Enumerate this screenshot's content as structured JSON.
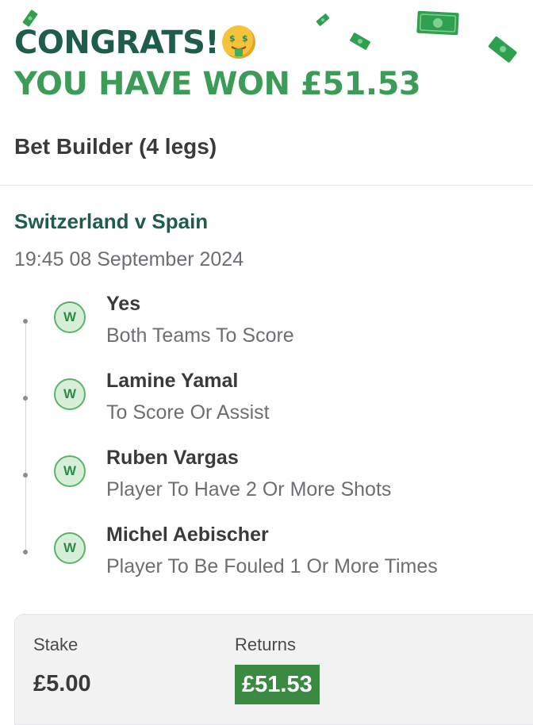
{
  "header": {
    "congrats_text": "CONGRATS!",
    "congrats_emoji": "money-mouth-face",
    "won_text": "YOU HAVE WON £51.53",
    "decor_icon": "money-bill-icon"
  },
  "bet": {
    "type_label": "Bet Builder (4 legs)",
    "match": "Switzerland v Spain",
    "datetime": "19:45 08 September 2024",
    "legs": [
      {
        "result": "W",
        "selection": "Yes",
        "market": "Both Teams To Score"
      },
      {
        "result": "W",
        "selection": "Lamine Yamal",
        "market": "To Score Or Assist"
      },
      {
        "result": "W",
        "selection": "Ruben Vargas",
        "market": "Player To Have 2 Or More Shots"
      },
      {
        "result": "W",
        "selection": "Michel Aebischer",
        "market": "Player To Be Fouled 1 Or More Times"
      }
    ]
  },
  "summary": {
    "stake_label": "Stake",
    "stake_value": "£5.00",
    "returns_label": "Returns",
    "returns_value": "£51.53"
  },
  "colors": {
    "brand_dark_green": "#1f5c4b",
    "win_green": "#3c9b57",
    "badge_bg": "#d7efd9",
    "returns_bg": "#3a8a43"
  }
}
